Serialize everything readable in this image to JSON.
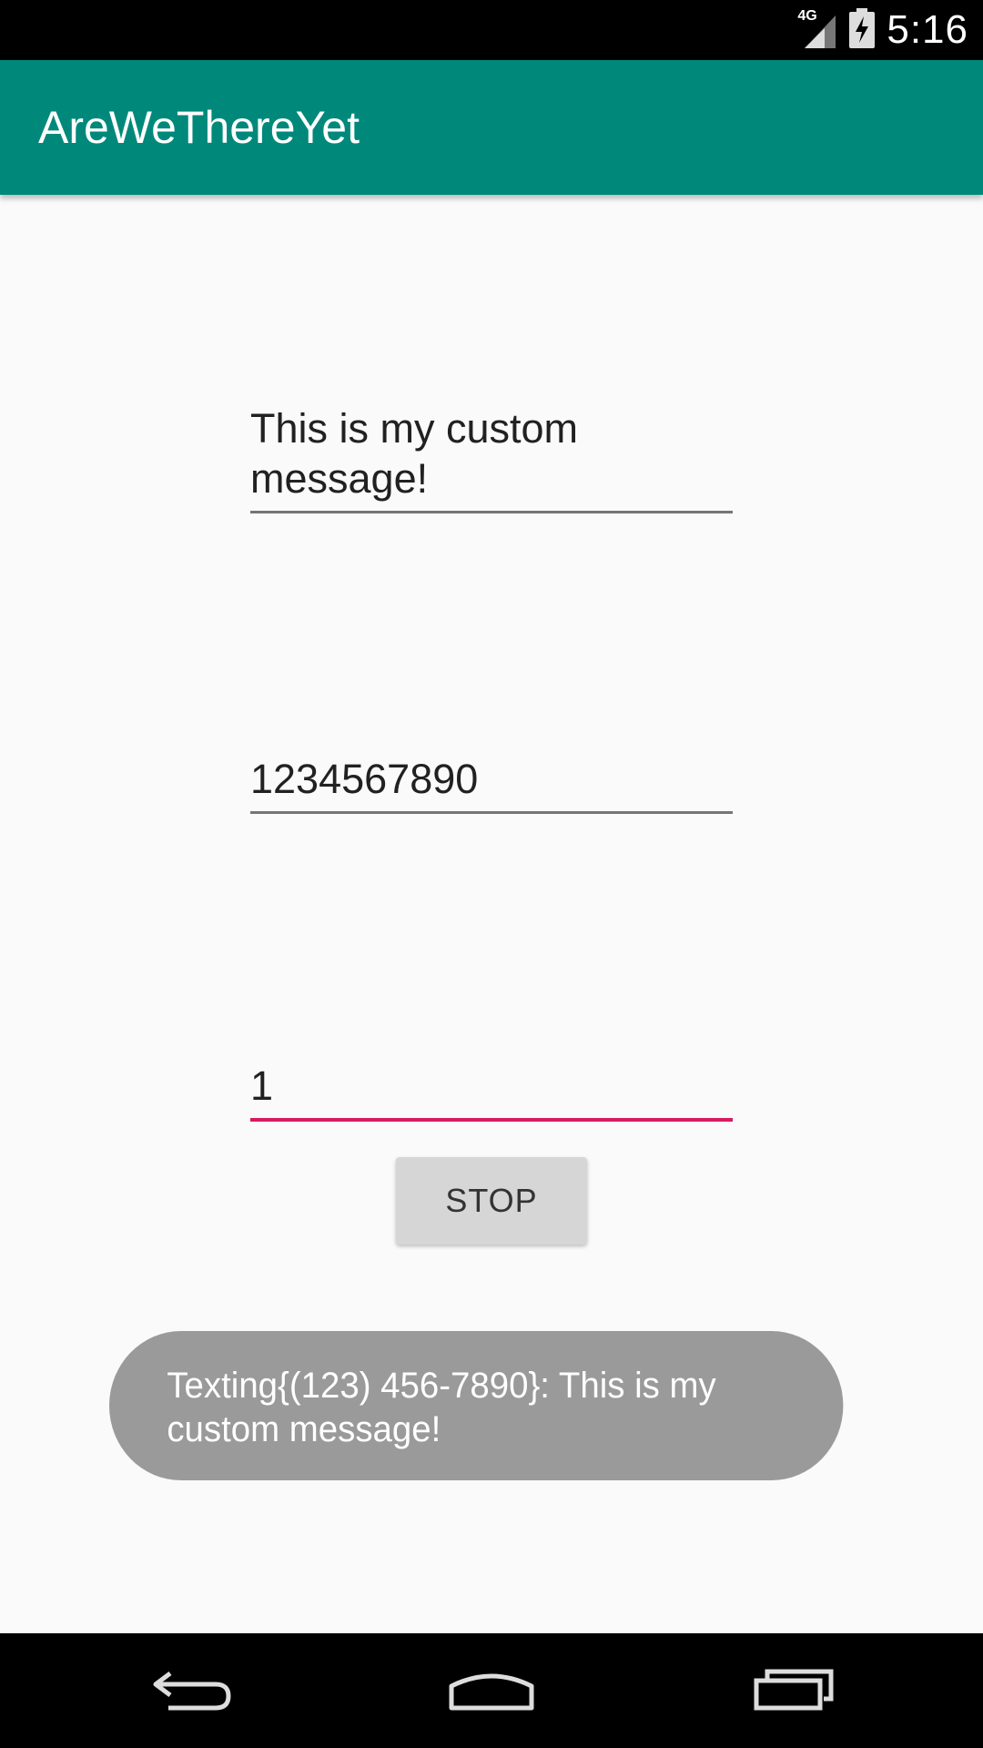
{
  "status_bar": {
    "network": "4G",
    "time": "5:16",
    "icons": [
      "signal-icon",
      "battery-charging-icon"
    ]
  },
  "app_bar": {
    "title": "AreWeThereYet",
    "color": "#00897b"
  },
  "form": {
    "message_value": "This is my custom message!",
    "phone_value": "1234567890",
    "interval_value": "1",
    "stop_label": "STOP"
  },
  "toast": {
    "text": "Texting{(123) 456-7890}: This is my custom message!"
  },
  "nav_bar": {
    "icons": [
      "back-icon",
      "home-icon",
      "recents-icon"
    ]
  },
  "colors": {
    "accent": "#d81b60",
    "primary": "#00897b"
  }
}
